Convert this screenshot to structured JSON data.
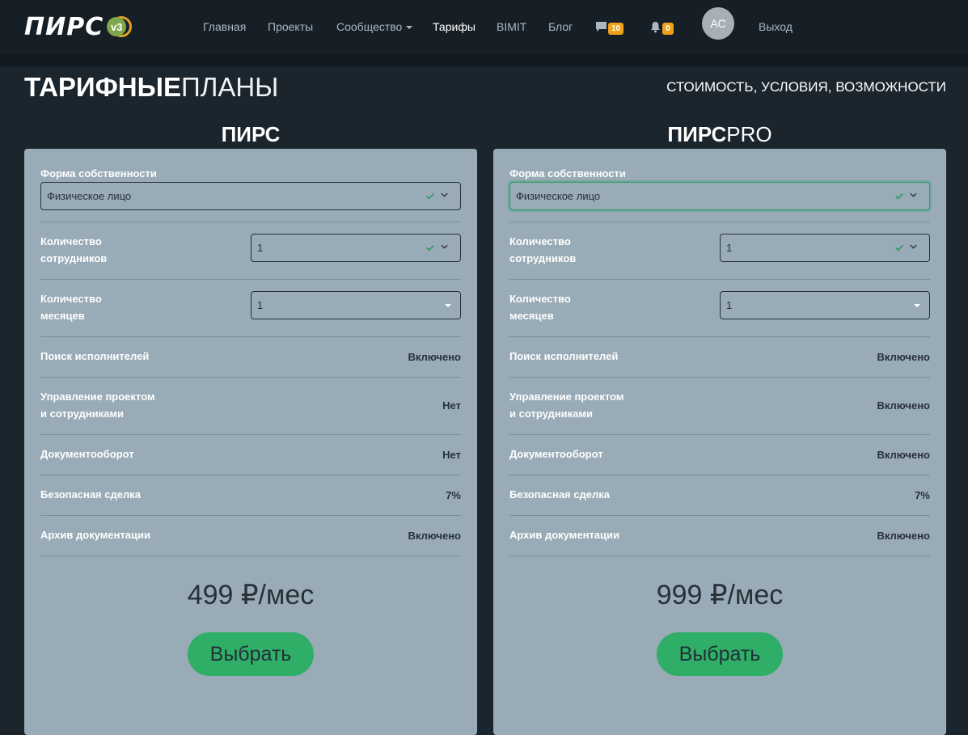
{
  "nav": {
    "logo_text": "ПИРС",
    "logo_version": "v3",
    "links": [
      "Главная",
      "Проекты",
      "Сообщество",
      "Тарифы",
      "BIMIT",
      "Блог"
    ],
    "messages_count": "10",
    "notifications_count": "0",
    "avatar_initials": "АС",
    "logout": "Выход"
  },
  "header": {
    "title_bold": "ТАРИФНЫЕ",
    "title_light": "ПЛАНЫ",
    "subtitle": "СТОИМОСТЬ, УСЛОВИЯ, ВОЗМОЖНОСТИ"
  },
  "plans": [
    {
      "name_bold": "ПИРС",
      "name_light": "",
      "ownership_label": "Форма собственности",
      "ownership_value": "Физическое лицо",
      "employees_label_1": "Количество",
      "employees_label_2": "сотрудников",
      "employees_value": "1",
      "months_label_1": "Количество",
      "months_label_2": "месяцев",
      "months_value": "1",
      "features": [
        {
          "label_1": "Поиск исполнителей",
          "label_2": "",
          "value": "Включено"
        },
        {
          "label_1": "Управление проектом",
          "label_2": "и сотрудниками",
          "value": "Нет"
        },
        {
          "label_1": "Документооборот",
          "label_2": "",
          "value": "Нет"
        },
        {
          "label_1": "Безопасная сделка",
          "label_2": "",
          "value": "7%"
        },
        {
          "label_1": "Архив документации",
          "label_2": "",
          "value": "Включено"
        }
      ],
      "price": "499 ₽/мес",
      "button": "Выбрать"
    },
    {
      "name_bold": "ПИРС",
      "name_light": "PRO",
      "ownership_label": "Форма собственности",
      "ownership_value": "Физическое лицо",
      "employees_label_1": "Количество",
      "employees_label_2": "сотрудников",
      "employees_value": "1",
      "months_label_1": "Количество",
      "months_label_2": "месяцев",
      "months_value": "1",
      "features": [
        {
          "label_1": "Поиск исполнителей",
          "label_2": "",
          "value": "Включено"
        },
        {
          "label_1": "Управление проектом",
          "label_2": "и сотрудниками",
          "value": "Включено"
        },
        {
          "label_1": "Документооборот",
          "label_2": "",
          "value": "Включено"
        },
        {
          "label_1": "Безопасная сделка",
          "label_2": "",
          "value": "7%"
        },
        {
          "label_1": "Архив документации",
          "label_2": "",
          "value": "Включено"
        }
      ],
      "price": "999 ₽/мес",
      "button": "Выбрать"
    }
  ],
  "colors": {
    "background": "#1b252d",
    "navbar": "#161f26",
    "card": "#98abb6",
    "accent_green": "#2fae67",
    "badge_orange": "#f0a019"
  }
}
